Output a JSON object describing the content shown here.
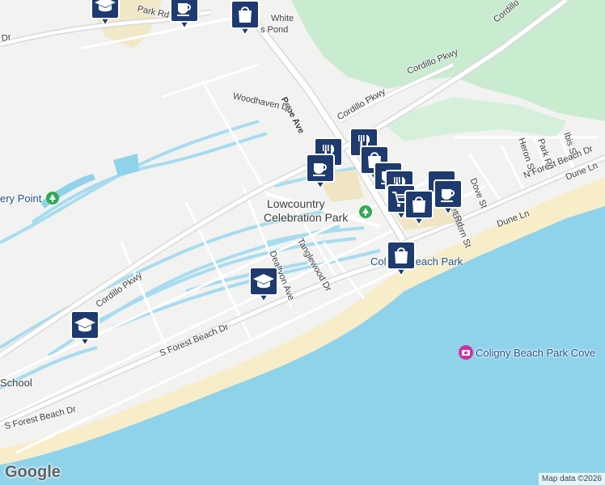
{
  "map": {
    "colors": {
      "land": "#f2f2f0",
      "water": "#8fd3ea",
      "canal": "#a7dcf0",
      "golf": "#c9ebd0",
      "beach": "#f7ecc4",
      "road": "#ffffff",
      "road_outline": "#d9d9d9",
      "marker_fill": "#1e3a6e",
      "marker_border": "#ffffff"
    },
    "labels": {
      "white_pond_1": "White",
      "white_pond_2": "s Pond",
      "park_rd_top": "Park Rd",
      "dr_top": "Dr",
      "cordillo_pkwy_top": "Cordillo Pkwy",
      "cordillo_top": "Cordillo",
      "pope_ave": "Pope Ave",
      "woodhaven_dr": "Woodhaven Dr",
      "cordillo_pkwy_mid": "Cordillo Pkwy",
      "ery_point": "ery Point",
      "lowcountry_1": "Lowcountry",
      "lowcountry_2": "Celebration Park",
      "heron_st": "Heron St",
      "park_rd": "Park Rd",
      "ibis_st": "Ibis St",
      "n_forest_beach_dr": "N Forest Beach Dr",
      "dune_ln_right": "Dune Ln",
      "dove_st": "Dove St",
      "dealtyon_ave": "Dealtyon Ave",
      "tanglewood_dr": "Tanglewood Dr",
      "bittern_st": "Bittern St",
      "et_rd": "et Rd",
      "dune_ln": "Dune Ln",
      "coligny_beach_park": "Coligny Beach Park",
      "cordillo_pkwy_left": "Cordillo Pkwy",
      "s_forest_beach_dr_1": "S Forest Beach Dr",
      "school": "School",
      "coligny_cove": "Coligny Beach Park Cove",
      "s_forest_beach_dr_2": "S Forest Beach Dr"
    },
    "markers": [
      {
        "name": "education-marker",
        "icon": "graduation-cap-icon"
      },
      {
        "name": "cafe-marker",
        "icon": "coffee-cup-icon"
      },
      {
        "name": "shopping-marker",
        "icon": "shopping-bag-icon"
      },
      {
        "name": "restaurant-marker",
        "icon": "fork-knife-icon"
      },
      {
        "name": "cafe-marker",
        "icon": "coffee-cup-icon"
      },
      {
        "name": "restaurant-marker",
        "icon": "fork-knife-icon"
      },
      {
        "name": "shopping-marker",
        "icon": "shopping-bag-icon"
      },
      {
        "name": "cafe-marker",
        "icon": "coffee-cup-icon"
      },
      {
        "name": "restaurant-marker",
        "icon": "fork-knife-icon"
      },
      {
        "name": "cafe-marker",
        "icon": "coffee-cup-icon"
      },
      {
        "name": "cafe-marker",
        "icon": "coffee-cup-icon"
      },
      {
        "name": "grocery-marker",
        "icon": "shopping-cart-icon"
      },
      {
        "name": "shopping-marker",
        "icon": "shopping-bag-icon"
      },
      {
        "name": "shopping-marker",
        "icon": "shopping-bag-icon"
      },
      {
        "name": "education-marker",
        "icon": "graduation-cap-icon"
      },
      {
        "name": "education-marker",
        "icon": "graduation-cap-icon"
      }
    ],
    "google_logo": "Google",
    "attribution": "Map data ©2026"
  }
}
